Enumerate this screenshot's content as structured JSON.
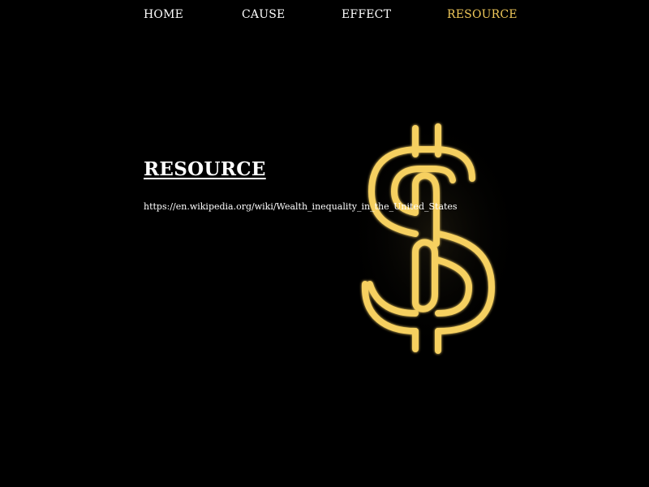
{
  "nav": {
    "items": [
      {
        "label": "HOME"
      },
      {
        "label": "CAUSE"
      },
      {
        "label": "EFFECT"
      },
      {
        "label": "RESOURCE",
        "active": true
      }
    ],
    "active_color": "#f1c95a",
    "text_color": "#ffffff"
  },
  "main": {
    "title": "RESOURCE",
    "link": "https://en.wikipedia.org/wiki/Wealth_inequality_in_the_United_States"
  },
  "background": {
    "color": "#000000",
    "image": "neon-dollar-sign",
    "neon_color": "#f6d060"
  }
}
